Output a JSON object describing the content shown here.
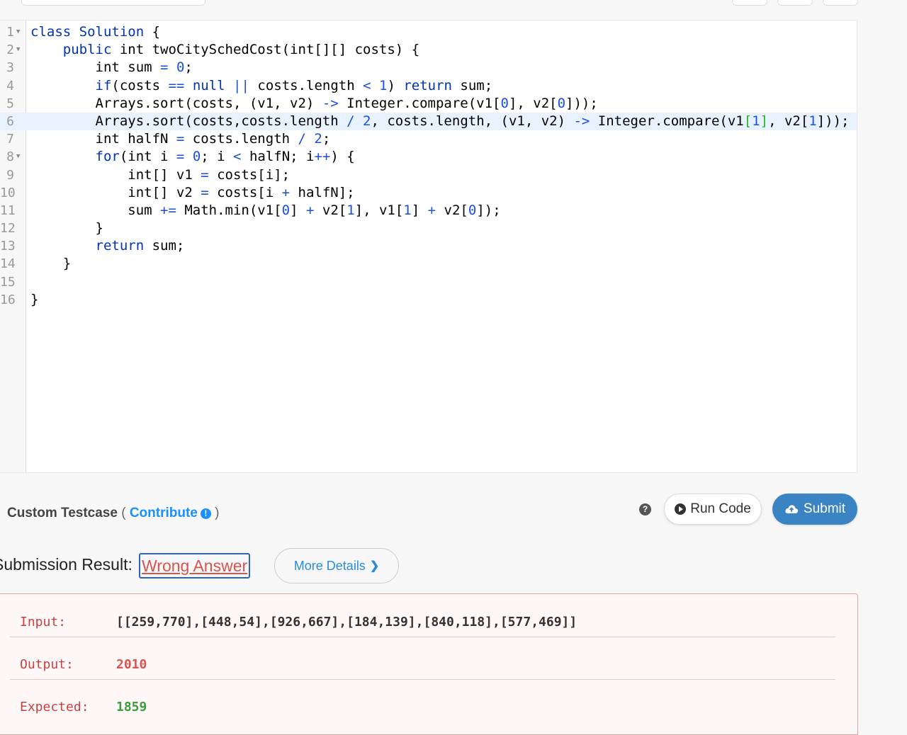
{
  "editor": {
    "lines": [
      {
        "num": "1",
        "fold": true,
        "active": false,
        "html": "<span class=\"kw\">class</span> <span class=\"kw\">Solution</span> {"
      },
      {
        "num": "2",
        "fold": true,
        "active": false,
        "html": "    <span class=\"kw\">public</span> int twoCitySchedCost(int[][] costs) {"
      },
      {
        "num": "3",
        "fold": false,
        "active": false,
        "html": "        int sum <span class=\"op\">=</span> <span class=\"num\">0</span>;"
      },
      {
        "num": "4",
        "fold": false,
        "active": false,
        "html": "        <span class=\"kw\">if</span>(costs <span class=\"op\">==</span> <span class=\"kw\">null</span> <span class=\"op\">||</span> costs.length <span class=\"op\">&lt;</span> <span class=\"num\">1</span>) <span class=\"kw\">return</span> sum;"
      },
      {
        "num": "5",
        "fold": false,
        "active": false,
        "html": "        Arrays.sort(costs, (v1, v2) <span class=\"op\">-&gt;</span> Integer.compare(v1[<span class=\"num\">0</span>], v2[<span class=\"num\">0</span>]));"
      },
      {
        "num": "6",
        "fold": false,
        "active": true,
        "html": "        Arrays.sort(costs,costs.length <span class=\"op\">/</span> <span class=\"num\">2</span>, costs.length, (v1, v2) <span class=\"op\">-&gt;</span> Integer.compare(v1<span class=\"match\">[</span><span class=\"num\">1</span><span class=\"match\">]</span>, v2[<span class=\"num\">1</span>]));"
      },
      {
        "num": "7",
        "fold": false,
        "active": false,
        "html": "        int halfN <span class=\"op\">=</span> costs.length <span class=\"op\">/</span> <span class=\"num\">2</span>;"
      },
      {
        "num": "8",
        "fold": true,
        "active": false,
        "html": "        <span class=\"kw\">for</span>(int i <span class=\"op\">=</span> <span class=\"num\">0</span>; i <span class=\"op\">&lt;</span> halfN; i<span class=\"op\">++</span>) {"
      },
      {
        "num": "9",
        "fold": false,
        "active": false,
        "html": "            int[] v1 <span class=\"op\">=</span> costs[i];"
      },
      {
        "num": "10",
        "fold": false,
        "active": false,
        "html": "            int[] v2 <span class=\"op\">=</span> costs[i <span class=\"op\">+</span> halfN];"
      },
      {
        "num": "11",
        "fold": false,
        "active": false,
        "html": "            sum <span class=\"op\">+=</span> Math.min(v1[<span class=\"num\">0</span>] <span class=\"op\">+</span> v2[<span class=\"num\">1</span>], v1[<span class=\"num\">1</span>] <span class=\"op\">+</span> v2[<span class=\"num\">0</span>]);"
      },
      {
        "num": "12",
        "fold": false,
        "active": false,
        "html": "        }"
      },
      {
        "num": "13",
        "fold": false,
        "active": false,
        "html": "        <span class=\"kw\">return</span> sum;"
      },
      {
        "num": "14",
        "fold": false,
        "active": false,
        "html": "    }"
      },
      {
        "num": "15",
        "fold": false,
        "active": false,
        "html": ""
      },
      {
        "num": "16",
        "fold": false,
        "active": false,
        "html": "}"
      }
    ]
  },
  "testcase": {
    "label": "Custom Testcase",
    "open_paren": "(",
    "contribute": "Contribute",
    "info_glyph": "!",
    "close_paren": ")",
    "help_glyph": "?"
  },
  "buttons": {
    "run_code": "Run Code",
    "submit": "Submit",
    "more_details": "More Details",
    "more_chevron": "❯"
  },
  "result": {
    "label": "Submission Result:",
    "status": "Wrong Answer",
    "status_color": "#d9534f",
    "input_label": "Input:",
    "input_value": "[[259,770],[448,54],[926,667],[184,139],[840,118],[577,469]]",
    "output_label": "Output:",
    "output_value": "2010",
    "expected_label": "Expected:",
    "expected_value": "1859"
  },
  "colors": {
    "submit_bg": "#3b84c4",
    "link": "#1a90ff",
    "expected": "#3a9c3a"
  }
}
